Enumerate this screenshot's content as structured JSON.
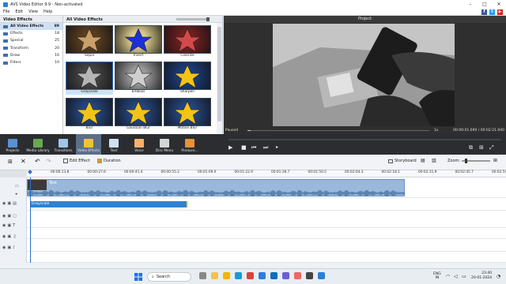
{
  "window": {
    "title": "AVS Video Editor 9.9 - Non-activated"
  },
  "menu": [
    "File",
    "Edit",
    "View",
    "Help"
  ],
  "social": [
    {
      "icon": "facebook-icon",
      "glyph": "f",
      "color": "#3b5998"
    },
    {
      "icon": "twitter-icon",
      "glyph": "t",
      "color": "#1da1f2"
    },
    {
      "icon": "youtube-icon",
      "glyph": "▶",
      "color": "#e62117"
    }
  ],
  "categories": {
    "header": "Video Effects",
    "items": [
      {
        "label": "All Video Effects",
        "count": "89",
        "selected": true
      },
      {
        "label": "Effects",
        "count": "18"
      },
      {
        "label": "Special",
        "count": "25"
      },
      {
        "label": "Transform",
        "count": "20"
      },
      {
        "label": "Draw",
        "count": "16"
      },
      {
        "label": "Filters",
        "count": "10"
      }
    ]
  },
  "effects": {
    "header": "All Video Effects",
    "items": [
      {
        "label": "Sepia",
        "bg": "#5a3d22",
        "star": "#c9a068"
      },
      {
        "label": "Invert",
        "bg": "#d9c98a",
        "star": "#1d2fd8"
      },
      {
        "label": "Colorize",
        "bg": "#6e1f1f",
        "star": "#d34a4a"
      },
      {
        "label": "Grayscale",
        "bg": "#444444",
        "star": "#b5b5b5",
        "selected": true
      },
      {
        "label": "Emboss",
        "bg": "#9a9a9a",
        "star": "#cfcfcf"
      },
      {
        "label": "Sharpen",
        "bg": "#1b3c7a",
        "star": "#f3c316"
      },
      {
        "label": "Blur",
        "bg": "#24457f",
        "star": "#f2c41a"
      },
      {
        "label": "Gaussian Blur",
        "bg": "#24457f",
        "star": "#f2c41a"
      },
      {
        "label": "Motion Blur",
        "bg": "#24457f",
        "star": "#f2c41a"
      }
    ]
  },
  "preview": {
    "header": "Project",
    "status": "Paused",
    "speed": "1x",
    "time": "00:00:01.690 / 00:02:21.940"
  },
  "toolbar": [
    {
      "label": "Projects",
      "icon": "projects-icon",
      "color": "#5a8fd1"
    },
    {
      "label": "Media Library",
      "icon": "media-library-icon",
      "color": "#6aa84f"
    },
    {
      "label": "Transitions",
      "icon": "transitions-icon",
      "color": "#9fc5e8"
    },
    {
      "label": "Video Effects",
      "icon": "video-effects-icon",
      "color": "#f1c232",
      "selected": true
    },
    {
      "label": "Text",
      "icon": "text-icon",
      "color": "#cfe2f3"
    },
    {
      "label": "Voice",
      "icon": "voice-icon",
      "color": "#f6b26b"
    },
    {
      "label": "Disc Menu",
      "icon": "disc-menu-icon",
      "color": "#d5d5d5"
    },
    {
      "label": "Produce...",
      "icon": "produce-icon",
      "color": "#e69138"
    }
  ],
  "timeline": {
    "edit_effect": "Edit Effect",
    "duration": "Duration",
    "storyboard": "Storyboard",
    "zoom": "Zoom:",
    "ticks": [
      "00:00:13.8",
      "00:00:27.6",
      "00:00:41.4",
      "00:00:55.2",
      "00:01:09.0",
      "00:01:22.9",
      "00:01:36.7",
      "00:01:50.5",
      "00:02:04.3",
      "00:02:18.1",
      "00:02:31.9",
      "00:02:45.7",
      "00:02:59.5"
    ],
    "video_clip_label": "Test",
    "effect_clip_label": "Grayscale"
  },
  "taskbar": {
    "search": "Search",
    "lang_top": "ENG",
    "lang_bottom": "IN",
    "time": "23:40",
    "date": "20-01-2024"
  }
}
